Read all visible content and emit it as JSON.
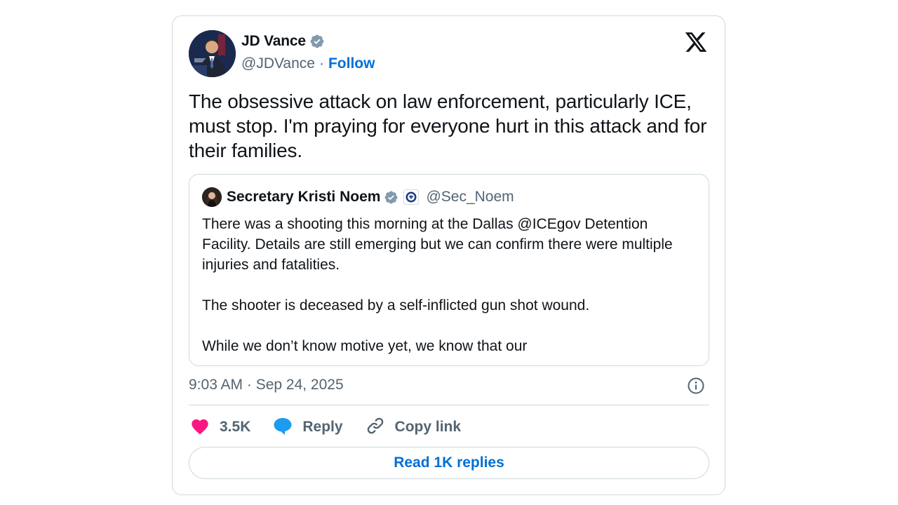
{
  "tweet": {
    "author": {
      "name": "JD Vance",
      "handle": "@JDVance",
      "separator": "·",
      "follow_label": "Follow",
      "verified_icon": "verified-badge-icon"
    },
    "text": "The obsessive attack on law enforcement, particularly ICE, must stop. I'm praying for everyone hurt in this attack and for their families.",
    "quoted": {
      "author_name": "Secretary Kristi Noem",
      "author_handle": "@Sec_Noem",
      "paragraphs": [
        "There was a shooting this morning at the Dallas @ICEgov Detention Facility. Details are still emerging but we can confirm there were multiple injuries and fatalities.",
        "The shooter is deceased by a self-inflicted gun shot wound.",
        "While we don’t know motive yet, we know that our"
      ]
    },
    "timestamp": "9:03 AM · Sep 24, 2025",
    "actions": {
      "like_count": "3.5K",
      "reply_label": "Reply",
      "copy_link_label": "Copy link"
    },
    "read_replies_label": "Read 1K replies"
  },
  "colors": {
    "accent": "#006fd6",
    "verified": "#829aab",
    "like": "#f91880",
    "reply": "#1d9bf0",
    "muted_text": "#536471",
    "border": "#cfd9de"
  }
}
